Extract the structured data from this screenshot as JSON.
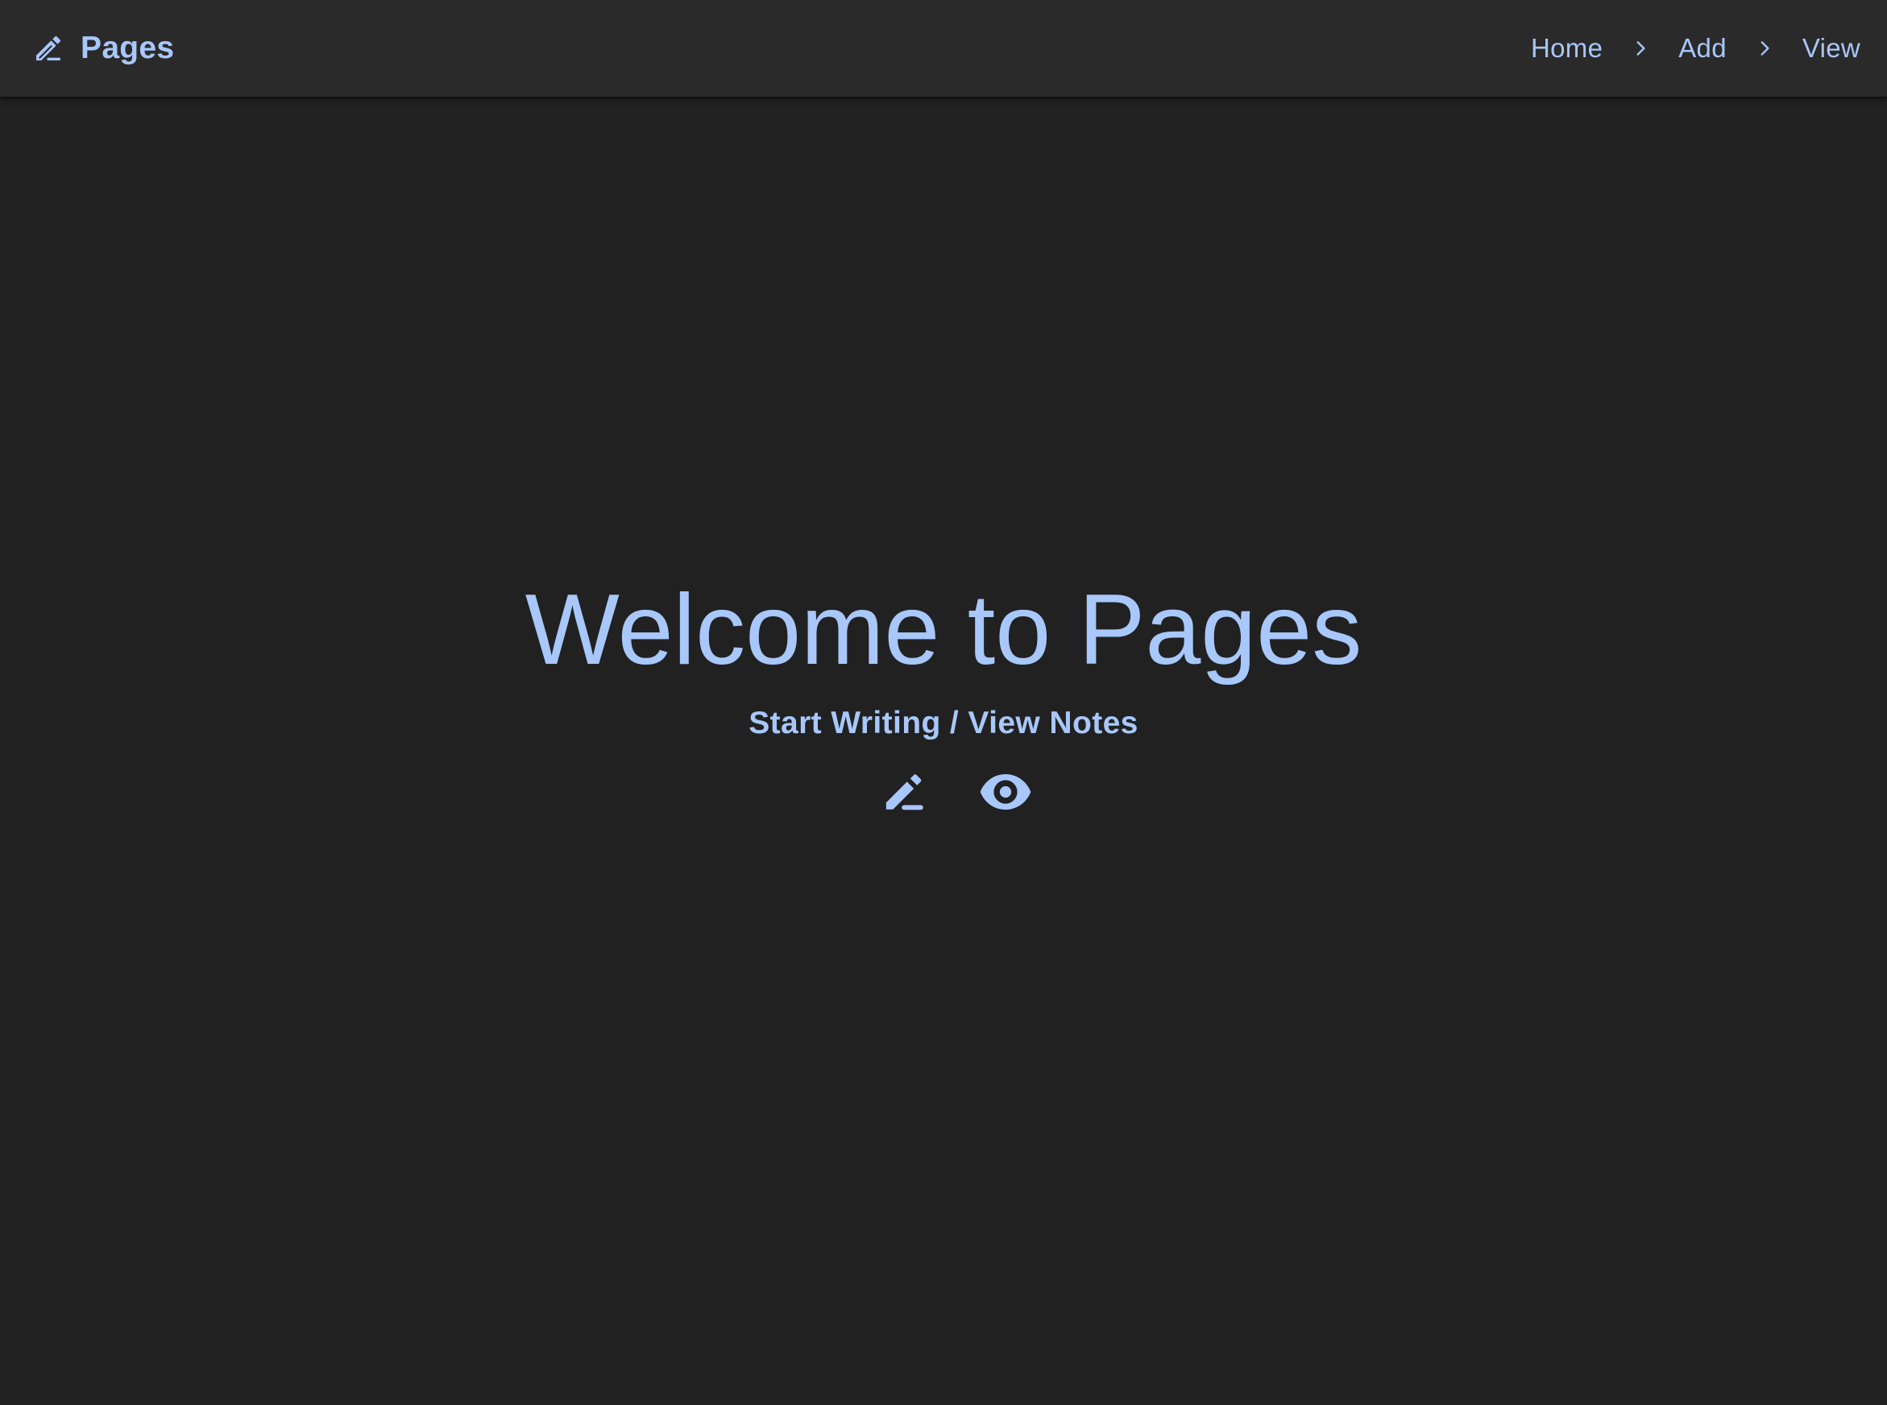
{
  "app": {
    "title": "Pages",
    "brand_icon": "edit-pencil-icon"
  },
  "breadcrumb": {
    "items": [
      {
        "label": "Home"
      },
      {
        "label": "Add"
      },
      {
        "label": "View"
      }
    ],
    "separator_icon": "chevron-right-icon"
  },
  "hero": {
    "title": "Welcome to Pages",
    "subtitle": "Start Writing / View Notes",
    "actions": [
      {
        "icon": "edit-pencil-icon",
        "action": "start-writing"
      },
      {
        "icon": "eye-icon",
        "action": "view-notes"
      }
    ]
  },
  "colors": {
    "background": "#212121",
    "topbar": "#2a2a2a",
    "accent": "#a8c7fa"
  }
}
